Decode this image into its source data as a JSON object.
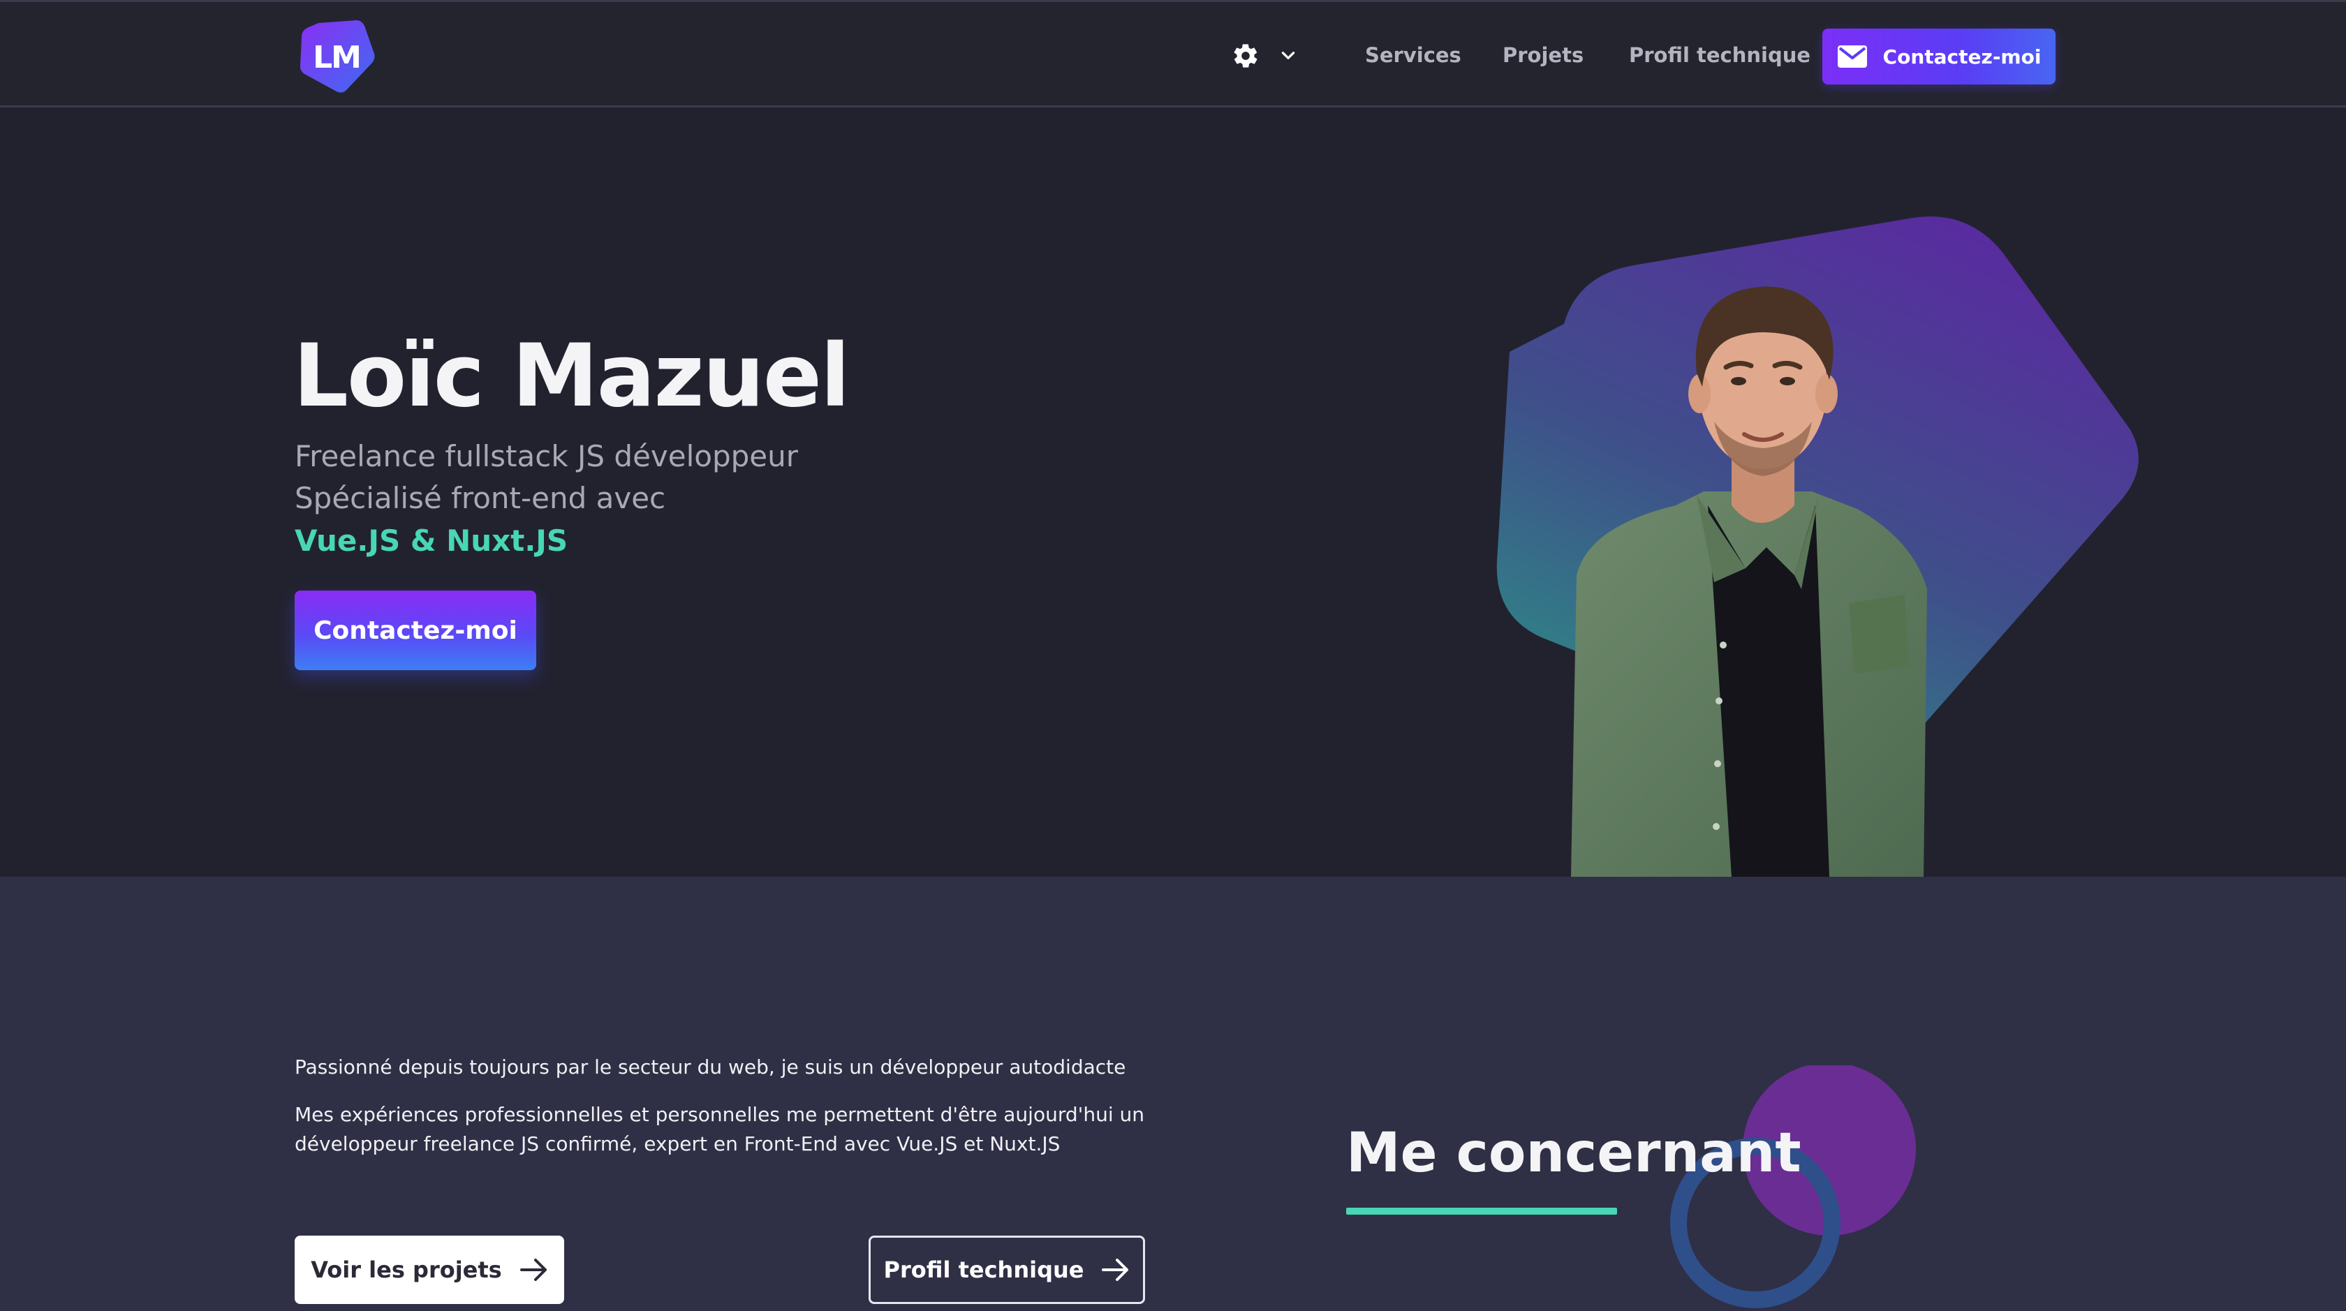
{
  "header": {
    "logo_text": "LM",
    "settings_icon": "gear-icon",
    "dropdown_icon": "chevron-down-icon",
    "nav": [
      "Services",
      "Projets",
      "Profil technique"
    ],
    "contact_label": "Contactez-moi",
    "contact_icon": "mail-icon"
  },
  "hero": {
    "name": "Loïc Mazuel",
    "line1": "Freelance fullstack JS développeur",
    "line2": "Spécialisé front-end avec",
    "accent_line": "Vue.JS & Nuxt.JS",
    "cta_label": "Contactez-moi"
  },
  "about": {
    "paragraph1": "Passionné depuis toujours par le secteur du web, je suis un développeur autodidacte",
    "paragraph2": "Mes expériences professionnelles et personnelles me permettent d'être aujourd'hui un développeur freelance JS confirmé, expert en Front-End avec Vue.JS et Nuxt.JS",
    "btn_projects": "Voir les projets",
    "btn_profile": "Profil technique",
    "arrow_icon": "arrow-right-icon",
    "section_title": "Me concernant"
  },
  "colors": {
    "background": "#22222f",
    "section_bg": "#2f2f45",
    "accent_teal": "#47d7b4",
    "accent_purple": "#7b2ff7",
    "accent_blue": "#4866f2"
  }
}
